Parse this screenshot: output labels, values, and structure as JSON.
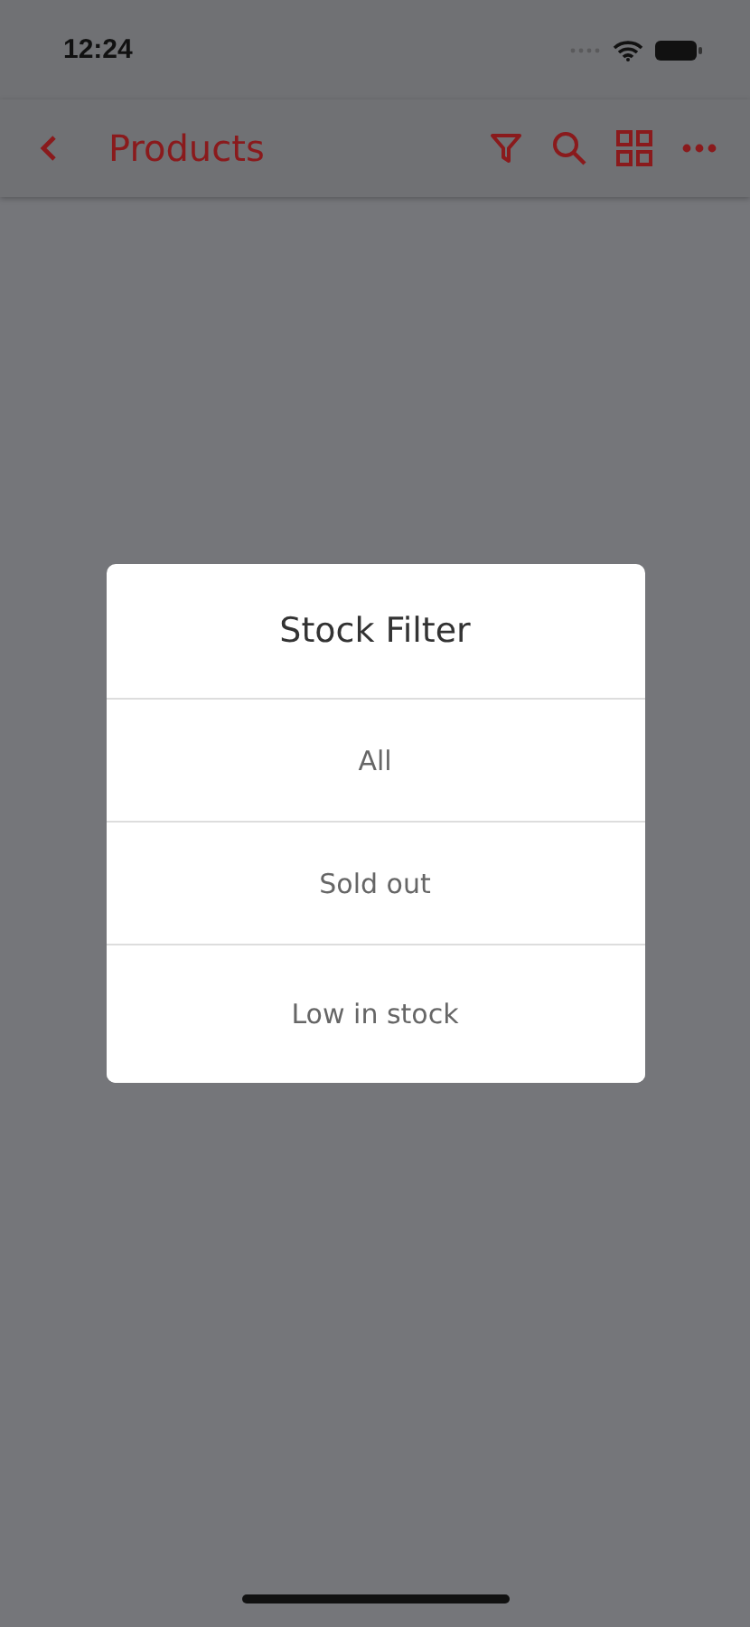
{
  "status_bar": {
    "time": "12:24"
  },
  "header": {
    "title": "Products"
  },
  "dialog": {
    "title": "Stock Filter",
    "options": [
      {
        "label": "All"
      },
      {
        "label": "Sold out"
      },
      {
        "label": "Low in stock"
      }
    ]
  }
}
